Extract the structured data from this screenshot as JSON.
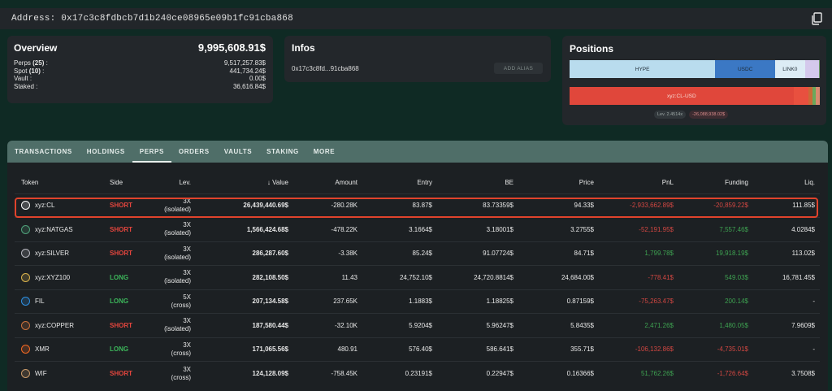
{
  "address_bar": {
    "label": "Address:",
    "address": "0x17c3c8fdbcb7d1b240ce08965e09b1fc91cba868"
  },
  "overview": {
    "title": "Overview",
    "total": "9,995,608.91$",
    "rows": [
      {
        "label": "Perps",
        "count": "(25)",
        "suffix": " :",
        "value": "9,517,257.83$"
      },
      {
        "label": "Spot",
        "count": "(10)",
        "suffix": " :",
        "value": "441,734.24$"
      },
      {
        "label": "Vault",
        "count": "",
        "suffix": " :",
        "value": "0.00$"
      },
      {
        "label": "Staked",
        "count": "",
        "suffix": " :",
        "value": "36,616.84$"
      }
    ]
  },
  "infos": {
    "title": "Infos",
    "short_address": "0x17c3c8fd...91cba868",
    "alias_button": "ADD ALIAS"
  },
  "positions": {
    "title": "Positions",
    "bar1": [
      {
        "label": "HYPE",
        "share": 0.582,
        "color": "#b9dcee"
      },
      {
        "label": "USDC",
        "share": 0.24,
        "color": "#3b78c4"
      },
      {
        "label": "LINK0",
        "share": 0.118,
        "color": "#dcecf5"
      },
      {
        "label": "",
        "share": 0.058,
        "color": "#d4c9ec"
      },
      {
        "label": "",
        "share": 0.002,
        "color": "#6e9d6a"
      }
    ],
    "bar2": [
      {
        "label": "xyz:CL-USD",
        "share": 0.895,
        "color": "#e0473b"
      },
      {
        "label": "",
        "share": 0.06,
        "color": "#e8503f"
      },
      {
        "label": "",
        "share": 0.015,
        "color": "#c96b37"
      },
      {
        "label": "",
        "share": 0.015,
        "color": "#6aa85b"
      },
      {
        "label": "",
        "share": 0.015,
        "color": "#d88b70"
      }
    ],
    "leverage_badge": "Lev. 2.4514x",
    "pnl_badge": "-26,088,938.02$"
  },
  "tabs": [
    "TRANSACTIONS",
    "HOLDINGS",
    "PERPS",
    "ORDERS",
    "VAULTS",
    "STAKING",
    "MORE"
  ],
  "active_tab": "PERPS",
  "table": {
    "headers": [
      "Token",
      "Side",
      "Lev.",
      "Value",
      "Amount",
      "Entry",
      "BE",
      "Price",
      "PnL",
      "Funding",
      "Liq."
    ],
    "sort_icon": "arrow-down-icon",
    "rows": [
      {
        "icon": "oil-drop-icon",
        "icon_color": "#ffffff",
        "token": "xyz:CL",
        "side": "SHORT",
        "lev1": "3X",
        "lev2": "(isolated)",
        "value": "26,439,440.69$",
        "amount": "-280.28K",
        "entry": "83.87$",
        "be": "83.73359$",
        "price": "94.33$",
        "pnl": "-2,933,662.89$",
        "funding": "-20,859.22$",
        "liq": "111.85$"
      },
      {
        "icon": "gas-icon",
        "icon_color": "#4fa07a",
        "token": "xyz:NATGAS",
        "side": "SHORT",
        "lev1": "3X",
        "lev2": "(isolated)",
        "value": "1,566,424.68$",
        "amount": "-478.22K",
        "entry": "3.1664$",
        "be": "3.18001$",
        "price": "3.2755$",
        "pnl": "-52,191.95$",
        "funding": "7,557.46$",
        "liq": "4.0284$"
      },
      {
        "icon": "silver-icon",
        "icon_color": "#b8b8c0",
        "token": "xyz:SILVER",
        "side": "SHORT",
        "lev1": "3X",
        "lev2": "(isolated)",
        "value": "286,287.60$",
        "amount": "-3.38K",
        "entry": "85.24$",
        "be": "91.07724$",
        "price": "84.71$",
        "pnl": "1,799.78$",
        "funding": "19,918.19$",
        "liq": "113.02$"
      },
      {
        "icon": "index-icon",
        "icon_color": "#d9b24c",
        "token": "xyz:XYZ100",
        "side": "LONG",
        "lev1": "3X",
        "lev2": "(isolated)",
        "value": "282,108.50$",
        "amount": "11.43",
        "entry": "24,752.10$",
        "be": "24,720.8814$",
        "price": "24,684.00$",
        "pnl": "-778.41$",
        "funding": "549.03$",
        "liq": "16,781.45$"
      },
      {
        "icon": "fil-icon",
        "icon_color": "#2e8fe0",
        "token": "FIL",
        "side": "LONG",
        "lev1": "5X",
        "lev2": "(cross)",
        "value": "207,134.58$",
        "amount": "237.65K",
        "entry": "1.1883$",
        "be": "1.18825$",
        "price": "0.87159$",
        "pnl": "-75,263.47$",
        "funding": "200.14$",
        "liq": "-"
      },
      {
        "icon": "copper-icon",
        "icon_color": "#c9713c",
        "token": "xyz:COPPER",
        "side": "SHORT",
        "lev1": "3X",
        "lev2": "(isolated)",
        "value": "187,580.44$",
        "amount": "-32.10K",
        "entry": "5.9204$",
        "be": "5.96247$",
        "price": "5.8435$",
        "pnl": "2,471.26$",
        "funding": "1,480.05$",
        "liq": "7.9609$"
      },
      {
        "icon": "monero-icon",
        "icon_color": "#f26822",
        "token": "XMR",
        "side": "LONG",
        "lev1": "3X",
        "lev2": "(cross)",
        "value": "171,065.56$",
        "amount": "480.91",
        "entry": "576.40$",
        "be": "586.641$",
        "price": "355.71$",
        "pnl": "-106,132.86$",
        "funding": "-4,735.01$",
        "liq": "-"
      },
      {
        "icon": "wif-icon",
        "icon_color": "#c99a6a",
        "token": "WIF",
        "side": "SHORT",
        "lev1": "3X",
        "lev2": "(cross)",
        "value": "124,128.09$",
        "amount": "-758.45K",
        "entry": "0.23191$",
        "be": "0.22947$",
        "price": "0.16366$",
        "pnl": "51,762.26$",
        "funding": "-1,726.64$",
        "liq": "3.7508$"
      }
    ]
  }
}
